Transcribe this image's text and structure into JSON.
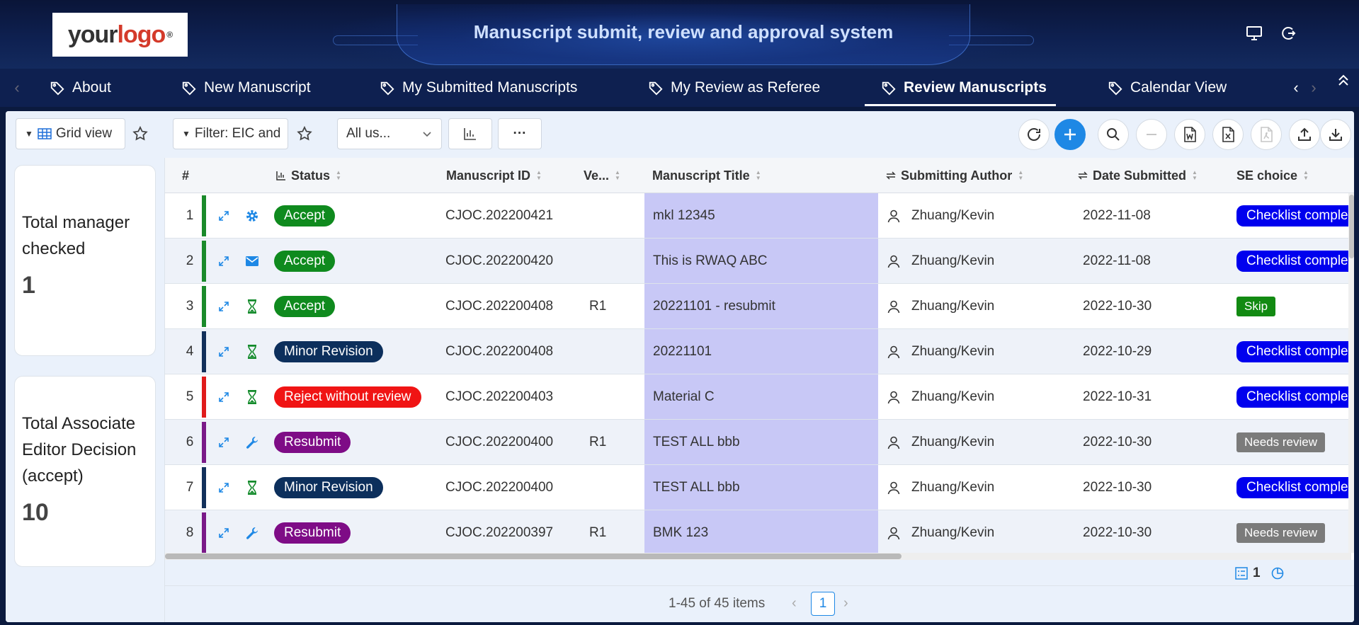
{
  "header": {
    "logo_your": "your",
    "logo_logo": "logo",
    "logo_mark": "®",
    "title": "Manuscript submit, review and approval system"
  },
  "tabs": [
    {
      "label": "About"
    },
    {
      "label": "New Manuscript"
    },
    {
      "label": "My Submitted Manuscripts"
    },
    {
      "label": "My Review as Referee"
    },
    {
      "label": "Review Manuscripts",
      "active": true
    },
    {
      "label": "Calendar View"
    }
  ],
  "toolbar": {
    "grid_view": "Grid view",
    "filter": "Filter: EIC and",
    "user_select": "All us...",
    "more": "···"
  },
  "cards": [
    {
      "label_lines": [
        "Total manager",
        "checked"
      ],
      "value": "1"
    },
    {
      "label_lines": [
        "Total Associate",
        "Editor Decision",
        "(accept)"
      ],
      "value": "10"
    }
  ],
  "columns": {
    "num": "#",
    "status": "Status",
    "manuscript_id": "Manuscript ID",
    "version": "Ve...",
    "title": "Manuscript Title",
    "author": "Submitting Author",
    "date": "Date Submitted",
    "se_choice": "SE choice"
  },
  "rows": [
    {
      "n": "1",
      "bar": "#1a8a2a",
      "icon": "gear-icon",
      "status": "Accept",
      "status_color": "#0f8a1e",
      "id": "CJOC.202200421",
      "ver": "",
      "title": "mkl 12345",
      "author": "Zhuang/Kevin",
      "date": "2022-11-08",
      "choice": "Checklist complete",
      "choice_color": "#0000ee",
      "choice_style": "pill"
    },
    {
      "n": "2",
      "bar": "#1a8a2a",
      "icon": "envelope-icon",
      "status": "Accept",
      "status_color": "#0f8a1e",
      "id": "CJOC.202200420",
      "ver": "",
      "title": "This is RWAQ ABC",
      "author": "Zhuang/Kevin",
      "date": "2022-11-08",
      "choice": "Checklist complete",
      "choice_color": "#0000ee",
      "choice_style": "pill"
    },
    {
      "n": "3",
      "bar": "#1a8a2a",
      "icon": "hourglass-icon",
      "status": "Accept",
      "status_color": "#0f8a1e",
      "id": "CJOC.202200408",
      "ver": "R1",
      "title": "20221101 - resubmit",
      "author": "Zhuang/Kevin",
      "date": "2022-10-30",
      "choice": "Skip",
      "choice_color": "#128a12",
      "choice_style": "tag"
    },
    {
      "n": "4",
      "bar": "#12305a",
      "icon": "hourglass-icon",
      "status": "Minor Revision",
      "status_color": "#0c2f5c",
      "id": "CJOC.202200408",
      "ver": "",
      "title": "20221101",
      "author": "Zhuang/Kevin",
      "date": "2022-10-29",
      "choice": "Checklist complete",
      "choice_color": "#0000ee",
      "choice_style": "pill"
    },
    {
      "n": "5",
      "bar": "#e01b1b",
      "icon": "hourglass-icon",
      "status": "Reject without review",
      "status_color": "#f01414",
      "id": "CJOC.202200403",
      "ver": "",
      "title": "Material C",
      "author": "Zhuang/Kevin",
      "date": "2022-10-31",
      "choice": "Checklist complete",
      "choice_color": "#0000ee",
      "choice_style": "pill"
    },
    {
      "n": "6",
      "bar": "#7a1a88",
      "icon": "wrench-icon",
      "status": "Resubmit",
      "status_color": "#7e0c86",
      "id": "CJOC.202200400",
      "ver": "R1",
      "title": "TEST ALL bbb",
      "author": "Zhuang/Kevin",
      "date": "2022-10-30",
      "choice": "Needs review",
      "choice_color": "#7b7b7b",
      "choice_style": "tag"
    },
    {
      "n": "7",
      "bar": "#12305a",
      "icon": "hourglass-icon",
      "status": "Minor Revision",
      "status_color": "#0c2f5c",
      "id": "CJOC.202200400",
      "ver": "",
      "title": "TEST ALL bbb",
      "author": "Zhuang/Kevin",
      "date": "2022-10-30",
      "choice": "Checklist complete",
      "choice_color": "#0000ee",
      "choice_style": "pill"
    },
    {
      "n": "8",
      "bar": "#7a1a88",
      "icon": "wrench-icon",
      "status": "Resubmit",
      "status_color": "#7e0c86",
      "id": "CJOC.202200397",
      "ver": "R1",
      "title": "BMK 123",
      "author": "Zhuang/Kevin",
      "date": "2022-10-30",
      "choice": "Needs review",
      "choice_color": "#7b7b7b",
      "choice_style": "tag"
    }
  ],
  "footer": {
    "selected_count": "1",
    "summary": "1-45 of 45 items",
    "page": "1"
  }
}
